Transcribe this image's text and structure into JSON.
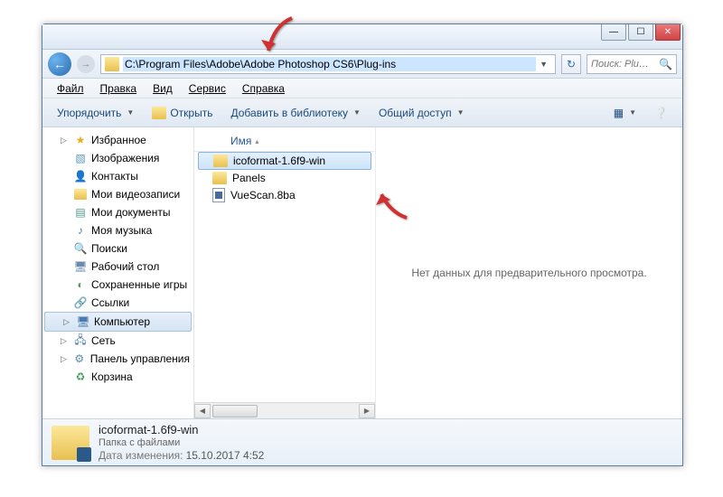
{
  "titlebar": {
    "min": "—",
    "max": "☐",
    "close": "✕"
  },
  "nav": {
    "path": "C:\\Program Files\\Adobe\\Adobe Photoshop CS6\\Plug-ins",
    "search_placeholder": "Поиск: Plu…",
    "back": "←",
    "fwd": "→",
    "refresh": "↻",
    "drop": "▼"
  },
  "menu": {
    "file": "Файл",
    "edit": "Правка",
    "view": "Вид",
    "tools": "Сервис",
    "help": "Справка"
  },
  "toolbar": {
    "organize": "Упорядочить",
    "open": "Открыть",
    "addlib": "Добавить в библиотеку",
    "share": "Общий доступ",
    "drop": "▼"
  },
  "sidebar": {
    "items": [
      {
        "label": "Избранное",
        "icon": "star"
      },
      {
        "label": "Изображения",
        "icon": "pics"
      },
      {
        "label": "Контакты",
        "icon": "contacts"
      },
      {
        "label": "Мои видеозаписи",
        "icon": "folder"
      },
      {
        "label": "Мои документы",
        "icon": "docs"
      },
      {
        "label": "Моя музыка",
        "icon": "music"
      },
      {
        "label": "Поиски",
        "icon": "search"
      },
      {
        "label": "Рабочий стол",
        "icon": "desktop"
      },
      {
        "label": "Сохраненные игры",
        "icon": "saves"
      },
      {
        "label": "Ссылки",
        "icon": "links"
      },
      {
        "label": "Компьютер",
        "icon": "computer"
      },
      {
        "label": "Сеть",
        "icon": "network"
      },
      {
        "label": "Панель управления",
        "icon": "panel"
      },
      {
        "label": "Корзина",
        "icon": "recycle"
      }
    ],
    "expand": "▷",
    "collapse": "▽"
  },
  "filelist": {
    "col_name": "Имя",
    "sort": "▴",
    "items": [
      {
        "label": "icoformat-1.6f9-win",
        "type": "folder",
        "selected": true
      },
      {
        "label": "Panels",
        "type": "folder"
      },
      {
        "label": "VueScan.8ba",
        "type": "doc"
      }
    ]
  },
  "preview": {
    "empty": "Нет данных для предварительного просмотра."
  },
  "scroll": {
    "left": "◀",
    "right": "▶"
  },
  "details": {
    "name": "icoformat-1.6f9-win",
    "type": "Папка с файлами",
    "date_label": "Дата изменения:",
    "date_value": "15.10.2017 4:52"
  }
}
